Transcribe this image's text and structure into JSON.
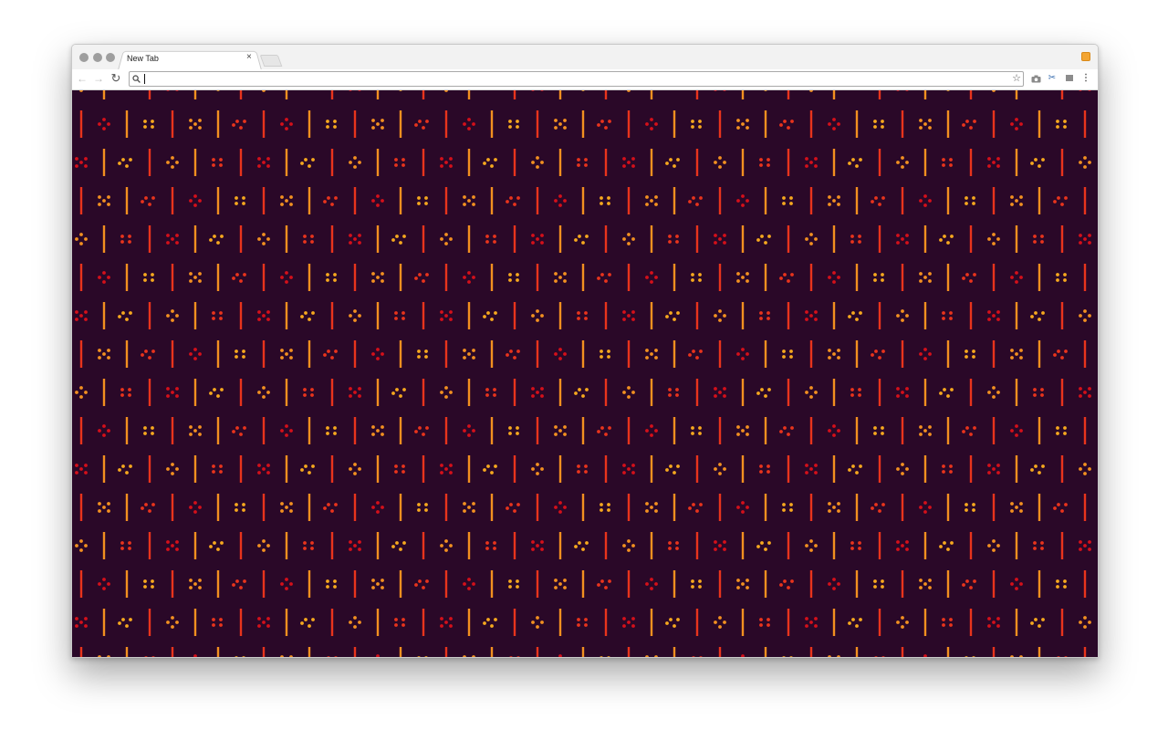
{
  "window": {
    "tab": {
      "title": "New Tab",
      "close_glyph": "×"
    },
    "toolbar": {
      "back_glyph": "←",
      "forward_glyph": "→",
      "reload_glyph": "↻",
      "search_glyph": "🔍",
      "address_value": "",
      "address_placeholder": "",
      "bookmark_glyph": "☆",
      "camera_glyph": "📷",
      "scissors_glyph": "✂",
      "menu_glyph": "⋮"
    }
  },
  "page": {
    "background_color": "#2a0828",
    "pattern_colors": [
      "#f29020",
      "#e8341c",
      "#d4101a",
      "#f6a81e"
    ]
  }
}
